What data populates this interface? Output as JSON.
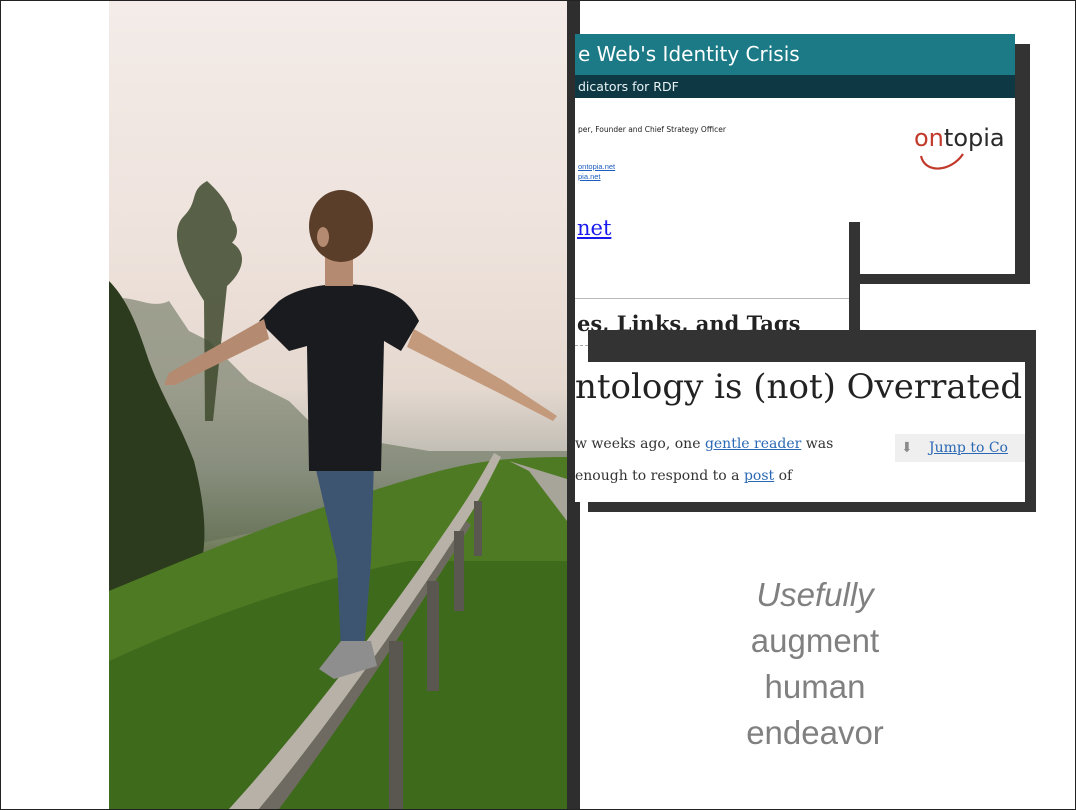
{
  "photo": {
    "alt": "boy balancing on a railing"
  },
  "shot1": {
    "title": "e Web's Identity Crisis",
    "subtitle": "dicators for RDF",
    "author": "per, Founder and Chief Strategy Officer",
    "link1": "ontopia.net",
    "link2": "pia.net",
    "logo_on": "on",
    "logo_topia": "topia"
  },
  "shot2": {
    "link": "net",
    "heading": "es, Links, and Tags"
  },
  "shot3": {
    "title": "ntology is (not) Overrated",
    "line1_pre": "w weeks ago, one ",
    "line1_link": "gentle reader",
    "line1_post": " was",
    "line2_pre": " enough to respond to a ",
    "line2_link": "post",
    "line2_post": " of",
    "jump_label": "Jump to Co"
  },
  "caption": {
    "emphasis": "Usefully",
    "line2": "augment",
    "line3": "human",
    "line4": "endeavor"
  },
  "colors": {
    "teal": "#1b7a86",
    "dark_teal": "#0e3944",
    "caption": "#808080"
  }
}
